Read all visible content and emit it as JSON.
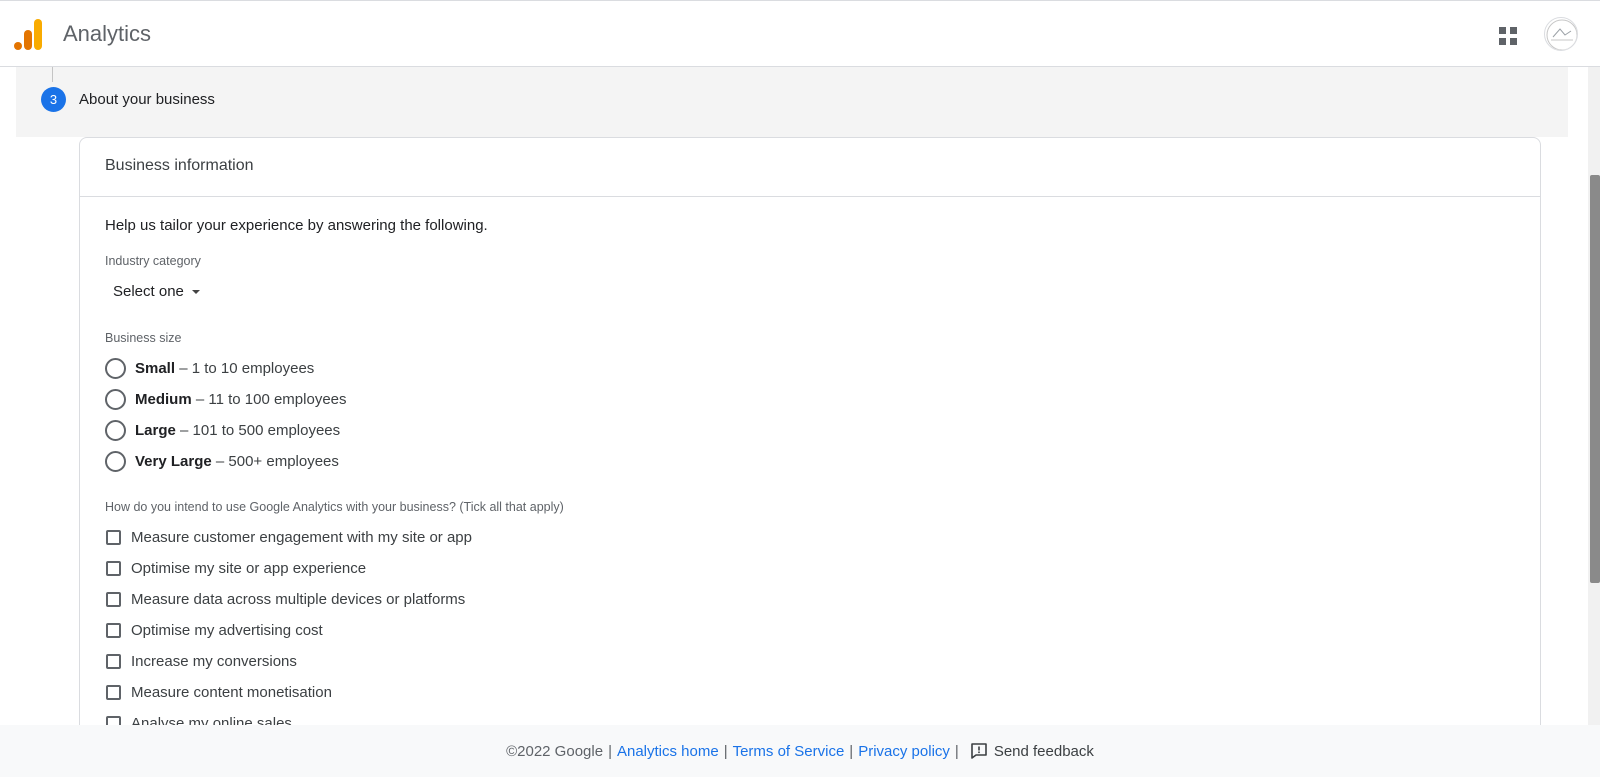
{
  "header": {
    "title": "Analytics"
  },
  "step": {
    "number": "3",
    "label": "About your business"
  },
  "card": {
    "title": "Business information",
    "intro": "Help us tailor your experience by answering the following.",
    "industry": {
      "label": "Industry category",
      "value": "Select one"
    },
    "size": {
      "label": "Business size",
      "options": [
        {
          "name": "Small",
          "desc": " – 1 to 10 employees"
        },
        {
          "name": "Medium",
          "desc": " – 11 to 100 employees"
        },
        {
          "name": "Large",
          "desc": " – 101 to 500 employees"
        },
        {
          "name": "Very Large",
          "desc": " – 500+ employees"
        }
      ]
    },
    "usage": {
      "label": "How do you intend to use Google Analytics with your business? (Tick all that apply)",
      "options": [
        "Measure customer engagement with my site or app",
        "Optimise my site or app experience",
        "Measure data across multiple devices or platforms",
        "Optimise my advertising cost",
        "Increase my conversions",
        "Measure content monetisation",
        "Analyse my online sales"
      ]
    }
  },
  "footer": {
    "copyright": "©2022 Google",
    "links": [
      "Analytics home",
      "Terms of Service",
      "Privacy policy"
    ],
    "feedback": "Send feedback",
    "separator": "|"
  },
  "colors": {
    "accent": "#1a73e8",
    "logo_dark": "#e37400",
    "logo_light": "#f9ab00"
  }
}
